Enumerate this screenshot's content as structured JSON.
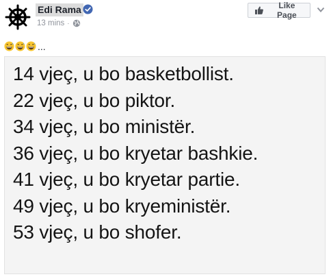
{
  "post": {
    "author": "Edi Rama",
    "timestamp": "13 mins",
    "dot": "·",
    "like_button": "Like Page",
    "caption_suffix": "...",
    "emojis": [
      "grinning-sweat-emoji",
      "grinning-sweat-emoji",
      "grinning-sweat-emoji"
    ],
    "lines": [
      "14 vjeç, u bo basketbollist.",
      "22 vjeç, u bo piktor.",
      "34 vjeç, u bo ministër.",
      "36 vjeç, u bo kryetar bashkie.",
      "41 vjeç, u bo kryetar partie.",
      "49 vjeç, u bo kryeministër.",
      "53 vjeç, u bo shofer."
    ]
  },
  "colors": {
    "verified_blue": "#4267b2",
    "button_bg": "#f6f7f9",
    "meta_gray": "#90949c"
  }
}
